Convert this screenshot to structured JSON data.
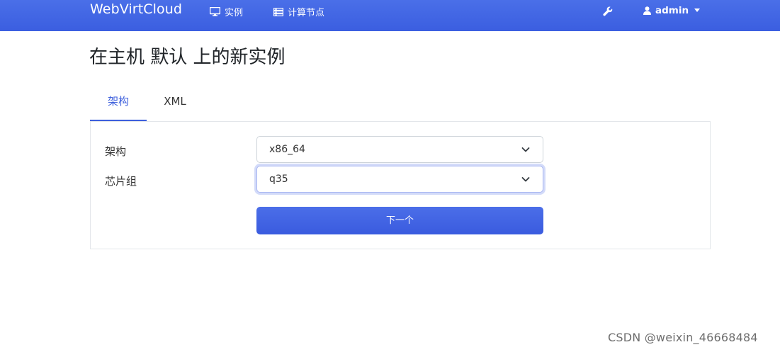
{
  "navbar": {
    "brand": "WebVirtCloud",
    "instances_label": "实例",
    "computes_label": "计算节点",
    "user_label": "admin",
    "bg_color": "#3b5ee0"
  },
  "page": {
    "title": "在主机 默认 上的新实例"
  },
  "tabs": [
    {
      "label": "架构",
      "active": true
    },
    {
      "label": "XML",
      "active": false
    }
  ],
  "form": {
    "arch_label": "架构",
    "arch_value": "x86_64",
    "chipset_label": "芯片组",
    "chipset_value": "q35",
    "next_button": "下一个"
  },
  "icons": {
    "instances": "monitor-icon",
    "computes": "server-icon",
    "tool": "wrench-icon",
    "user": "user-icon",
    "select": "chevron-down-icon"
  },
  "watermark": "CSDN @weixin_46668484"
}
